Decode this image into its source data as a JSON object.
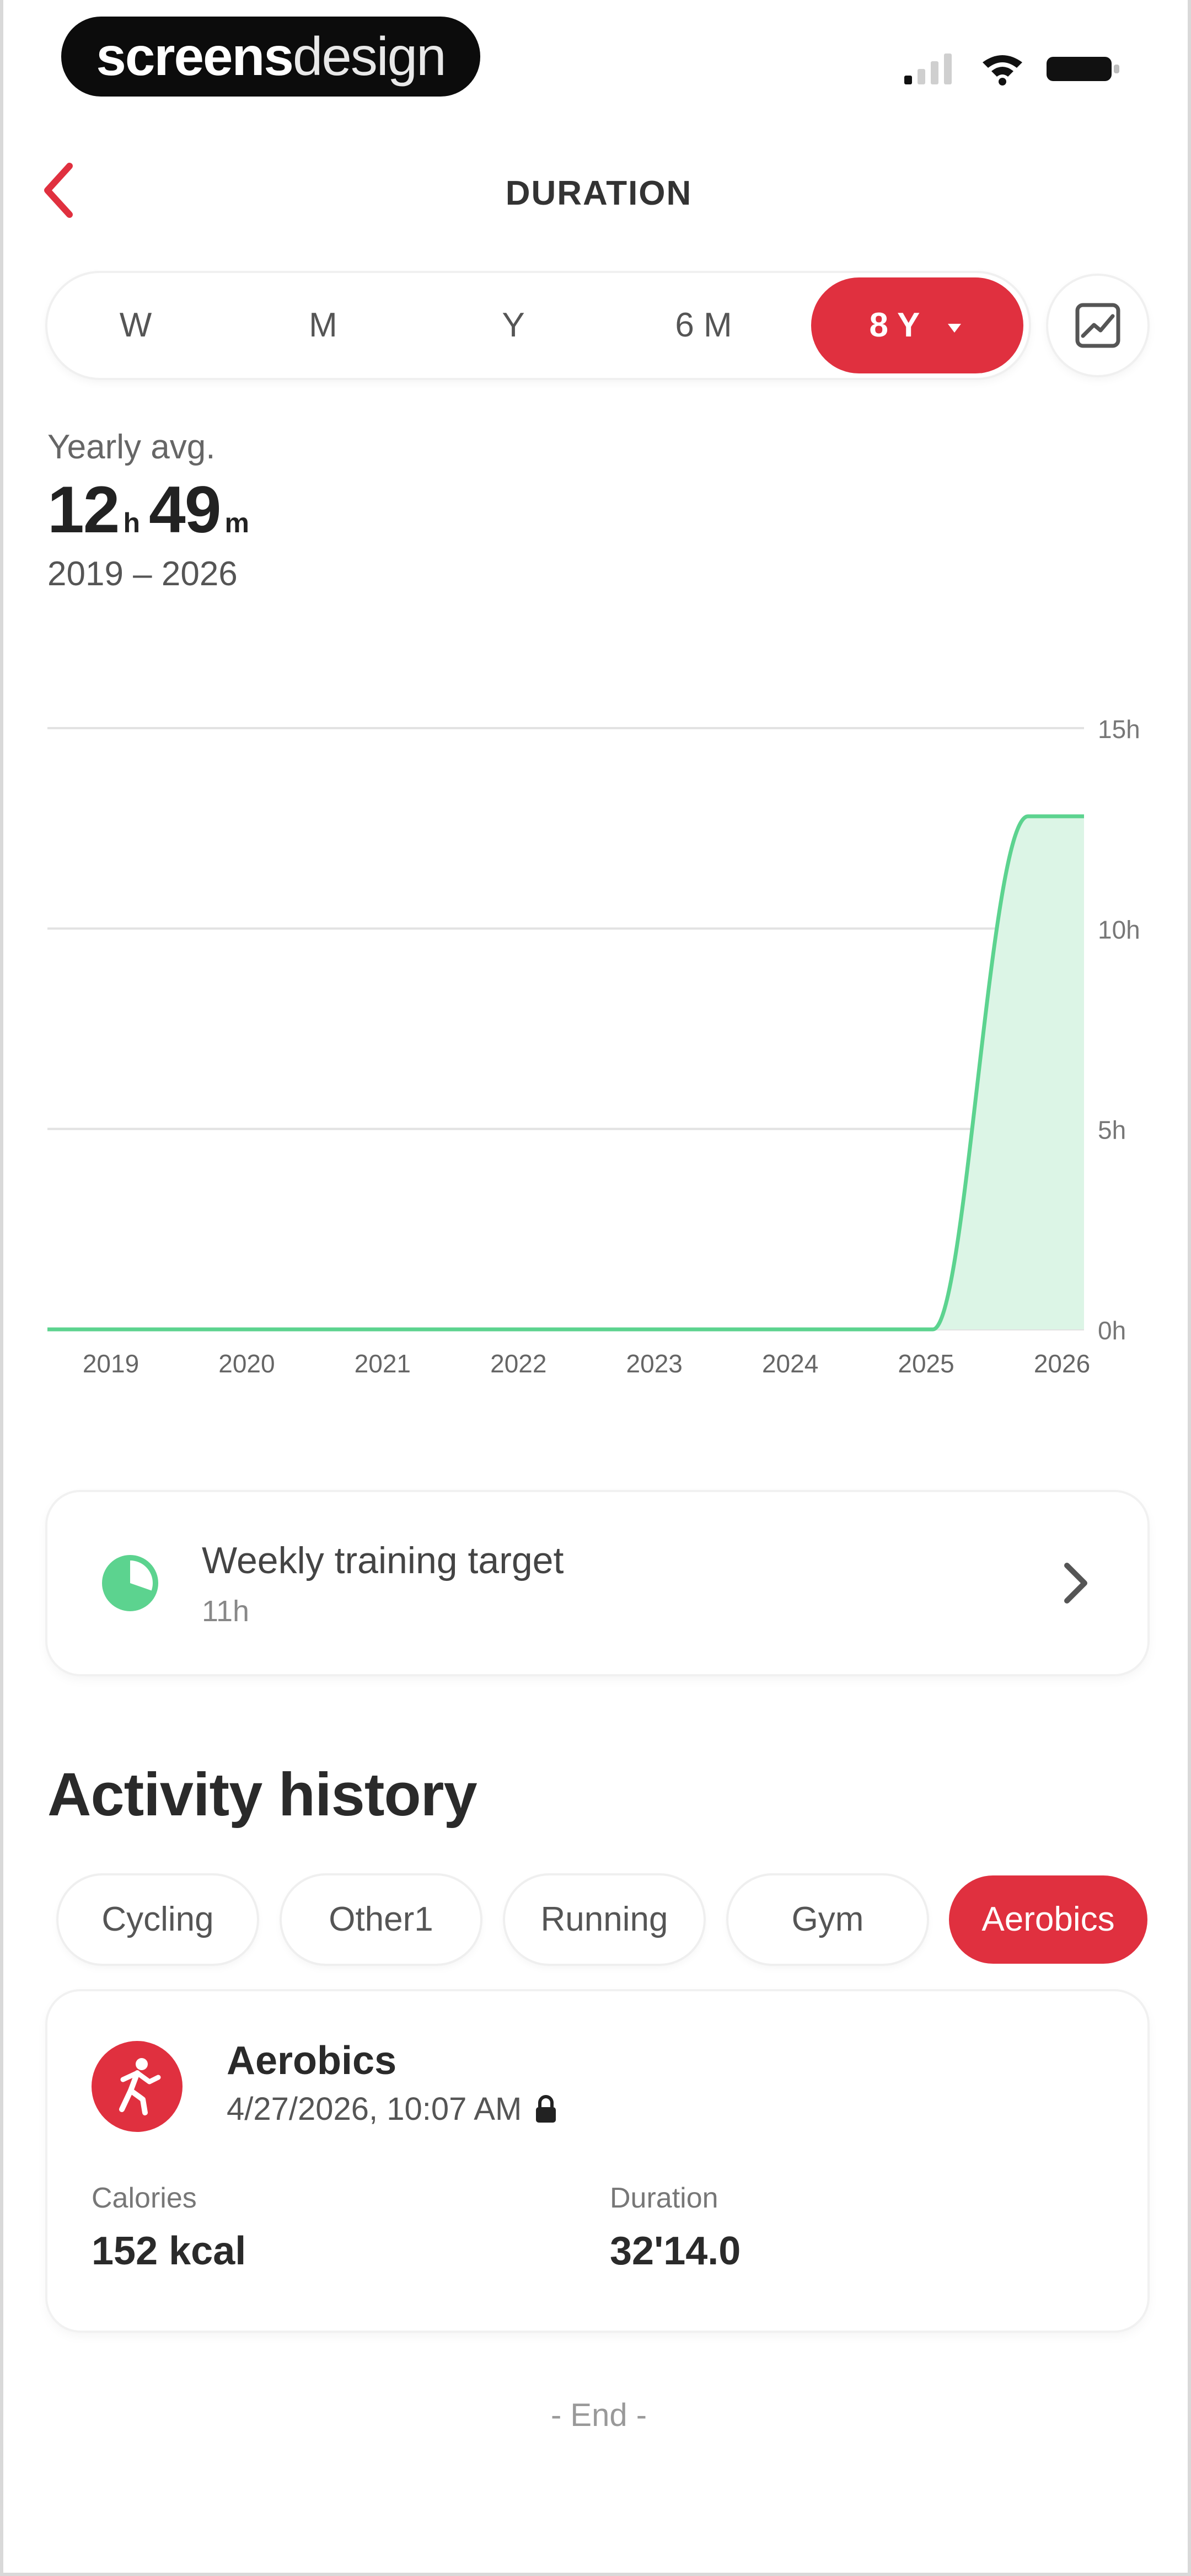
{
  "status_bar": {
    "brand_bold": "screens",
    "brand_light": "design",
    "icons": [
      "signal-icon",
      "wifi-icon",
      "battery-icon"
    ]
  },
  "header": {
    "title": "DURATION",
    "back_icon": "chevron-left-icon"
  },
  "period_tabs": {
    "items": [
      {
        "label": "W",
        "active": false
      },
      {
        "label": "M",
        "active": false
      },
      {
        "label": "Y",
        "active": false
      },
      {
        "label": "6 M",
        "active": false
      },
      {
        "label": "8 Y",
        "active": true
      }
    ],
    "active_dropdown_icon": "caret-down-icon",
    "chart_toggle_icon": "chart-view-icon"
  },
  "summary": {
    "label": "Yearly avg.",
    "hours": "12",
    "hours_unit": "h",
    "minutes": "49",
    "minutes_unit": "m",
    "range": "2019 – 2026"
  },
  "chart_data": {
    "type": "area",
    "x": [
      "2019",
      "2020",
      "2021",
      "2022",
      "2023",
      "2024",
      "2025",
      "2026"
    ],
    "values": [
      0,
      0,
      0,
      0,
      0,
      0,
      0,
      12.8
    ],
    "y_tick_labels": [
      "0h",
      "5h",
      "10h",
      "15h"
    ],
    "y_ticks": [
      0,
      5,
      10,
      15
    ],
    "ylim": [
      0,
      15
    ],
    "grid": true,
    "line_color": "#5cd38f",
    "fill_color": "#dcf5e6"
  },
  "target_card": {
    "title": "Weekly training target",
    "value": "11h",
    "icon": "target-progress-icon",
    "chevron_icon": "chevron-right-icon"
  },
  "activity_history": {
    "title": "Activity history",
    "filters": [
      {
        "label": "Cycling",
        "active": false
      },
      {
        "label": "Other1",
        "active": false
      },
      {
        "label": "Running",
        "active": false
      },
      {
        "label": "Gym",
        "active": false
      },
      {
        "label": "Aerobics",
        "active": true
      }
    ],
    "entries": [
      {
        "name": "Aerobics",
        "date": "4/27/2026, 10:07 AM",
        "icon": "aerobics-icon",
        "lock_icon": "lock-icon",
        "calories_label": "Calories",
        "calories_value": "152 kcal",
        "duration_label": "Duration",
        "duration_value": "32'14.0"
      }
    ],
    "end_label": "- End -"
  },
  "colors": {
    "accent": "#e0303f",
    "chart_line": "#5cd38f",
    "chart_fill": "#dcf5e6"
  }
}
